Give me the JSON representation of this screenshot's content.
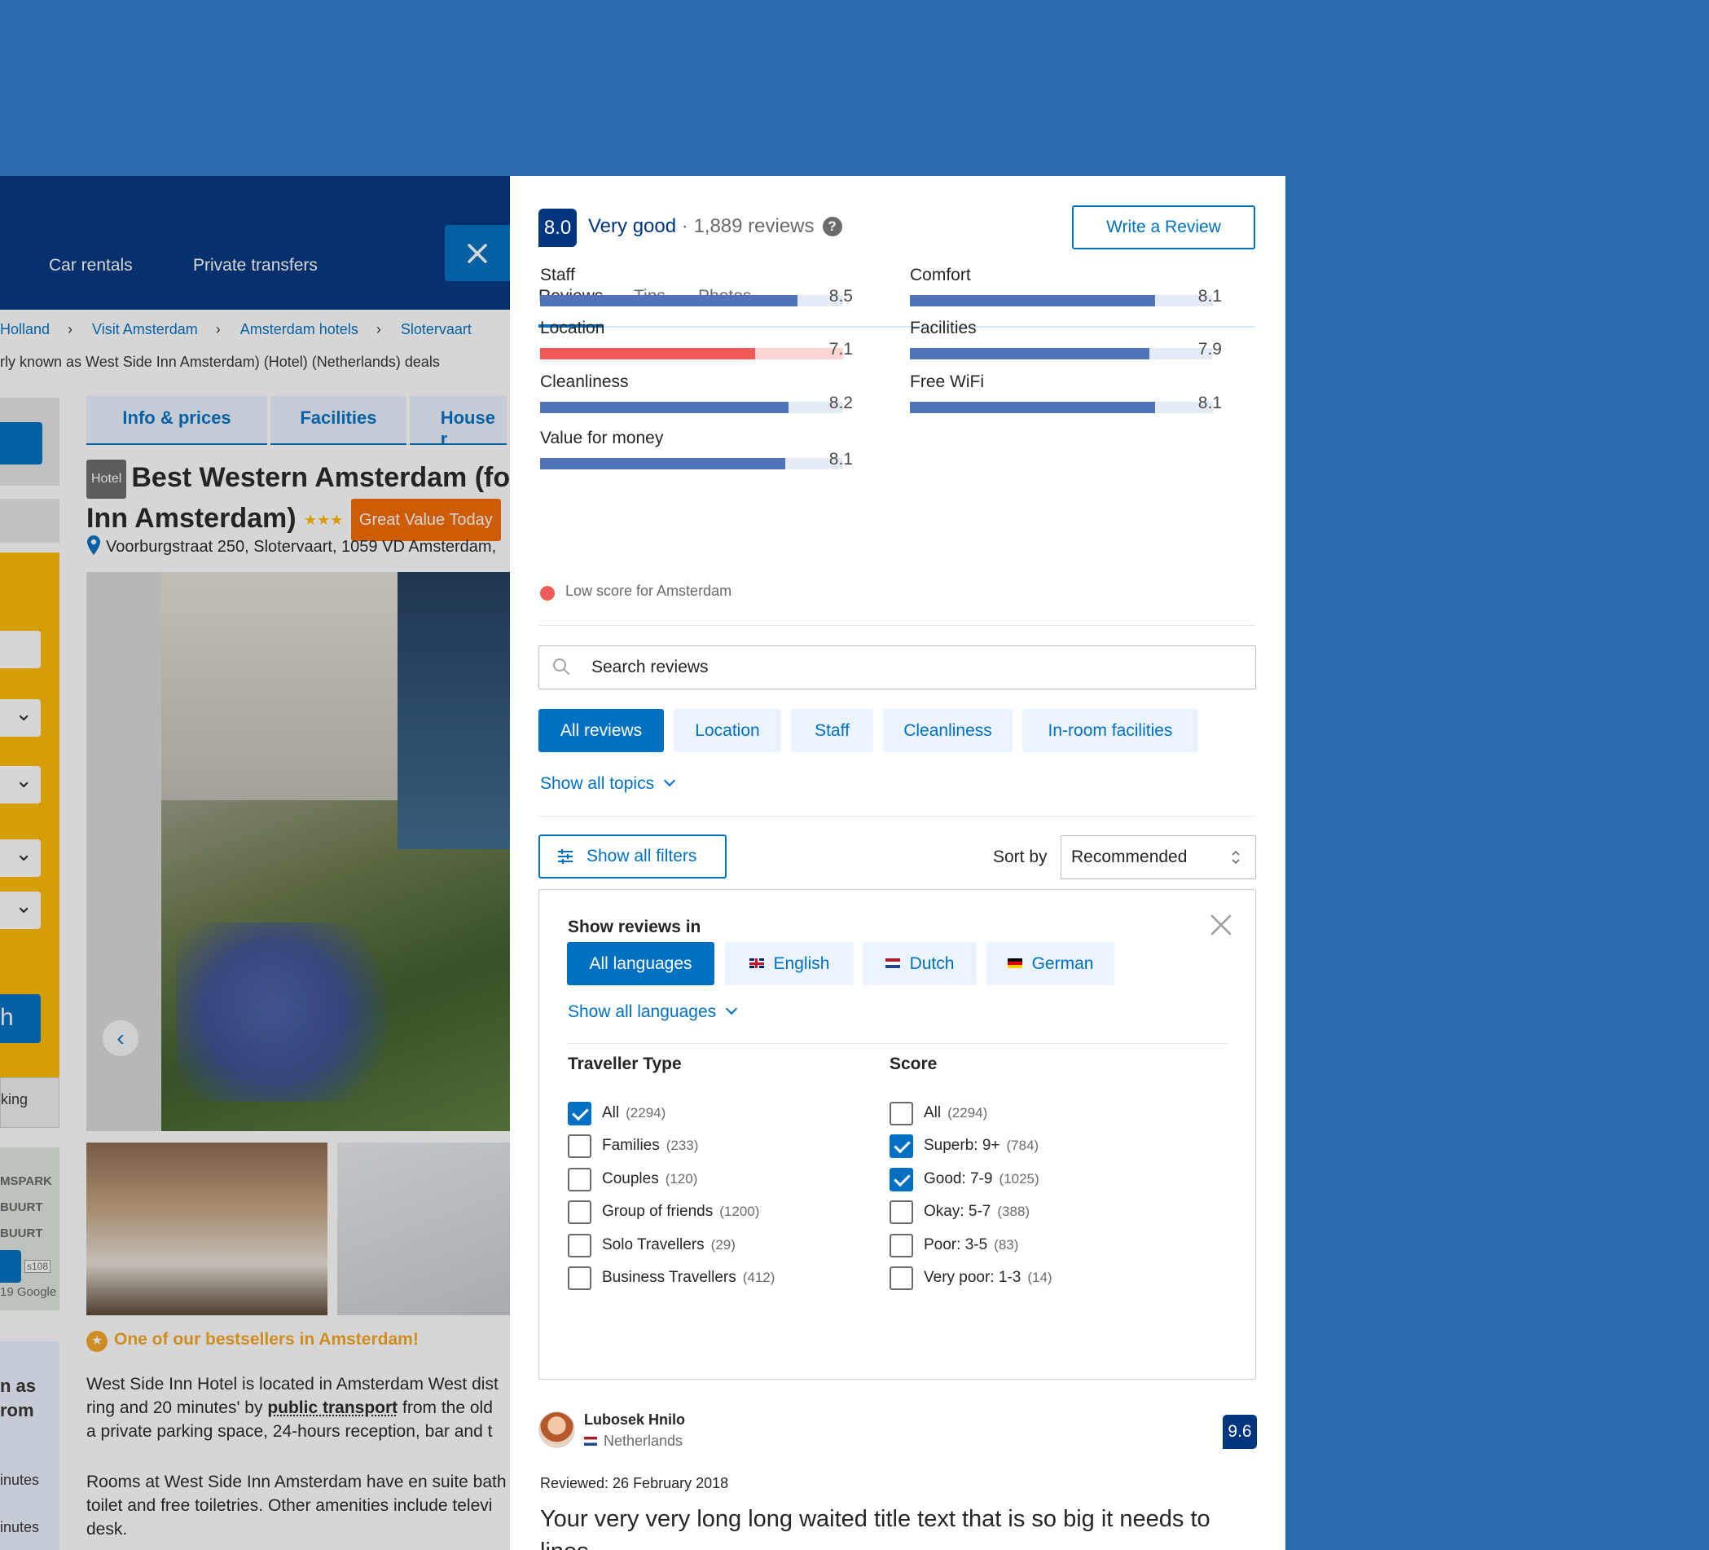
{
  "background_page": {
    "nav": [
      "Car rentals",
      "Private transfers"
    ],
    "breadcrumbs": [
      "Holland",
      "Visit Amsterdam",
      "Amsterdam hotels",
      "Slotervaart"
    ],
    "full_name_line": "rly known as West Side Inn Amsterdam) (Hotel) (Netherlands) deals",
    "tabs": [
      "Info & prices",
      "Facilities",
      "House r"
    ],
    "property_type": "Hotel",
    "title_line1": "Best Western Amsterdam (fo",
    "title_line2": "Inn Amsterdam)",
    "stars": "★★★",
    "deal_badge": "Great Value Today",
    "address": "Voorburgstraat 250, Slotervaart, 1059 VD Amsterdam,",
    "left_snippets": {
      "parking": "king",
      "map_labels": [
        "MSPARK",
        "BUURT",
        "BUURT"
      ],
      "map_road": "s108",
      "map_copyright": "19 Google",
      "big_lines": [
        "n as",
        "rom"
      ],
      "minutes": [
        "inutes",
        "inutes"
      ],
      "search_btn": "h"
    },
    "bestseller": "One of our bestsellers in Amsterdam!",
    "desc_lines": [
      "West Side Inn Hotel is located in Amsterdam West dist",
      "ring and 20 minutes' by",
      "public transport",
      "from the old",
      "a private parking space, 24-hours reception, bar and t"
    ],
    "desc2_lines": [
      "Rooms at West Side Inn Amsterdam have en suite bath",
      "toilet and free toiletries. Other amenities include televi",
      "desk."
    ]
  },
  "panel": {
    "score": "8.0",
    "verdict": "Very good",
    "separator": "·",
    "review_count": "1,889 reviews",
    "help_icon": "?",
    "write_review": "Write a Review",
    "tabs": [
      "Reviews",
      "Tips",
      "Photos"
    ],
    "categories": [
      {
        "label": "Staff",
        "score": "8.5",
        "value": 8.5
      },
      {
        "label": "Comfort",
        "score": "8.1",
        "value": 8.1
      },
      {
        "label": "Location",
        "score": "7.1",
        "value": 7.1,
        "low": true
      },
      {
        "label": "Facilities",
        "score": "7.9",
        "value": 7.9
      },
      {
        "label": "Cleanliness",
        "score": "8.2",
        "value": 8.2
      },
      {
        "label": "Free WiFi",
        "score": "8.1",
        "value": 8.1
      },
      {
        "label": "Value for money",
        "score": "8.1",
        "value": 8.1
      }
    ],
    "low_score_note": "Low score for Amsterdam",
    "search_placeholder": "Search reviews",
    "topics": [
      "All reviews",
      "Location",
      "Staff",
      "Cleanliness",
      "In-room facilities"
    ],
    "show_all_topics": "Show all topics",
    "show_all_filters": "Show all filters",
    "sort_by_label": "Sort by",
    "sort_value": "Recommended",
    "filters": {
      "title": "Show reviews in",
      "languages": [
        "All languages",
        "English",
        "Dutch",
        "German"
      ],
      "show_all_languages": "Show all languages",
      "traveller_type_title": "Traveller Type",
      "traveller_types": [
        {
          "label": "All",
          "count": "(2294)",
          "checked": true
        },
        {
          "label": "Families",
          "count": "(233)",
          "checked": false
        },
        {
          "label": "Couples",
          "count": "(120)",
          "checked": false
        },
        {
          "label": "Group of friends",
          "count": "(1200)",
          "checked": false
        },
        {
          "label": "Solo Travellers",
          "count": "(29)",
          "checked": false
        },
        {
          "label": "Business Travellers",
          "count": "(412)",
          "checked": false
        }
      ],
      "score_title": "Score",
      "scores": [
        {
          "label": "All",
          "count": "(2294)",
          "checked": false
        },
        {
          "label": "Superb: 9+",
          "count": "(784)",
          "checked": true
        },
        {
          "label": "Good: 7-9",
          "count": "(1025)",
          "checked": true
        },
        {
          "label": "Okay: 5-7",
          "count": "(388)",
          "checked": false
        },
        {
          "label": "Poor: 3-5",
          "count": "(83)",
          "checked": false
        },
        {
          "label": "Very poor: 1-3",
          "count": "(14)",
          "checked": false
        }
      ]
    },
    "review": {
      "name": "Lubosek Hnilo",
      "country": "Netherlands",
      "score": "9.6",
      "date": "Reviewed: 26 February 2018",
      "title": "Your very very long long waited title text that is so big it needs to lines"
    }
  },
  "colors": {
    "backdrop": "#2b6cb0",
    "brand_dark": "#003580",
    "brand_blue": "#0071c2",
    "bar_fill": "#5174b8",
    "low_score": "#f05a57",
    "chip_bg": "#ebf3ff"
  }
}
